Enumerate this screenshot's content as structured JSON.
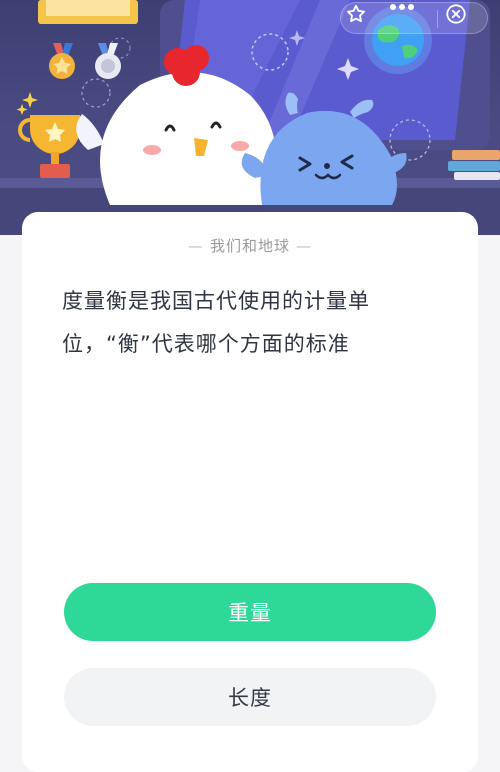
{
  "capsule": {
    "favorite_icon": "star-outline-icon",
    "more_icon": "more-dots-icon",
    "close_icon": "close-circle-icon"
  },
  "hero": {
    "trophy_icon": "trophy-icon",
    "medal_icons": [
      "gold-medal-icon",
      "silver-medal-icon"
    ],
    "characters": [
      "chicken-mascot",
      "blue-creature-mascot"
    ],
    "earth_icon": "earth-globe-icon"
  },
  "quiz": {
    "section_title": "我们和地球",
    "question_line1": "度量衡是我国古代使用的计量单",
    "question_line2": "位，“衡”代表哪个方面的标准",
    "options": [
      {
        "label": "重量",
        "style": "primary"
      },
      {
        "label": "长度",
        "style": "secondary"
      }
    ]
  },
  "colors": {
    "accent_green": "#2ed897",
    "hero_background": "#4a4b82",
    "card_background": "#ffffff"
  }
}
